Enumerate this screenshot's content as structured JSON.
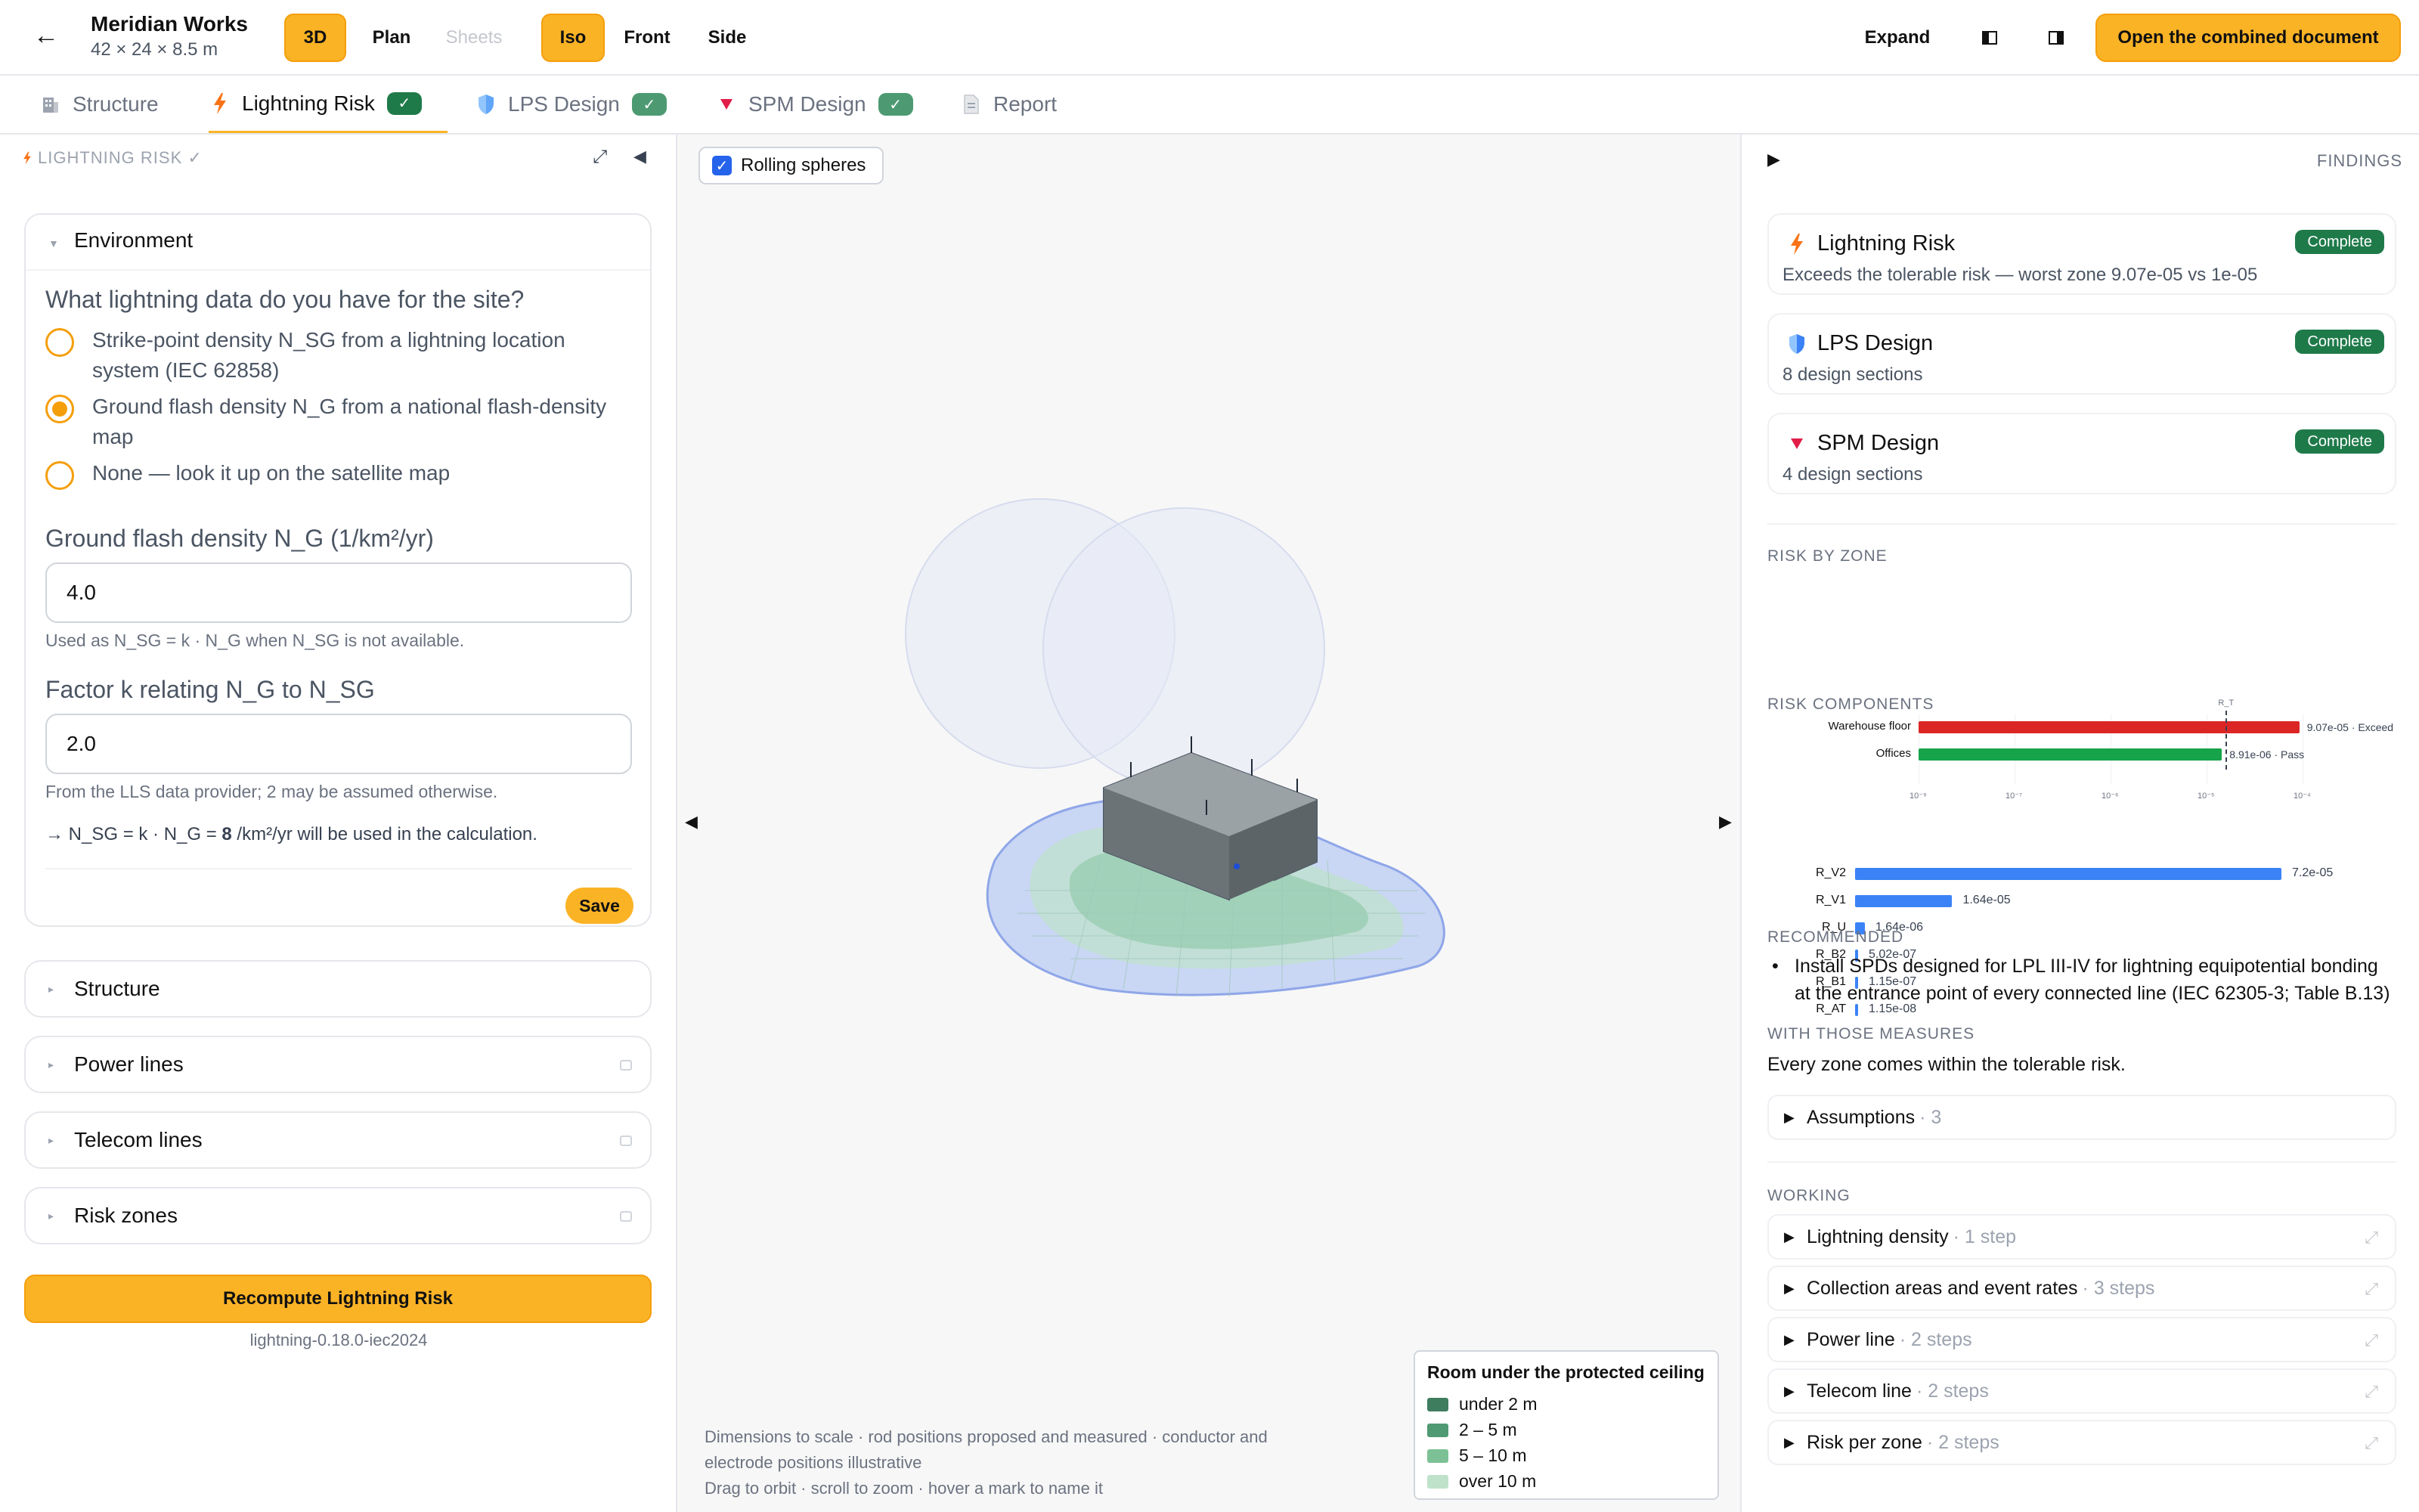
{
  "project": {
    "name": "Meridian Works",
    "dims": "42 × 24 × 8.5 m"
  },
  "toolbar": {
    "back": "←",
    "views": [
      "3D",
      "Plan",
      "Sheets"
    ],
    "cams": [
      "Iso",
      "Front",
      "Side"
    ],
    "expand": "Expand",
    "open_doc": "Open the combined document"
  },
  "tabs": [
    {
      "label": "Structure",
      "icon": "building-icon"
    },
    {
      "label": "Lightning Risk",
      "icon": "lightning-icon",
      "check": "✓"
    },
    {
      "label": "LPS Design",
      "icon": "shield-icon",
      "check": "✓"
    },
    {
      "label": "SPM Design",
      "icon": "triangle-icon",
      "check": "✓"
    },
    {
      "label": "Report",
      "icon": "document-icon"
    }
  ],
  "left": {
    "header": "LIGHTNING RISK ✓",
    "environment": {
      "title": "Environment",
      "question": "What lightning data do you have for the site?",
      "options": [
        "Strike-point density N_SG from a lightning location system (IEC 62858)",
        "Ground flash density N_G from a national flash-density map",
        "None — look it up on the satellite map"
      ],
      "selected_index": 1,
      "ng_label": "Ground flash density N_G (1/km²/yr)",
      "ng_value": "4.0",
      "ng_hint": "Used as N_SG = k · N_G when N_SG is not available.",
      "k_label": "Factor k relating N_G to N_SG",
      "k_value": "2.0",
      "k_hint": "From the LLS data provider; 2 may be assumed otherwise.",
      "calc_prefix": "→ N_SG = k · N_G = ",
      "calc_value": "8",
      "calc_suffix": " /km²/yr will be used in the calculation.",
      "save": "Save"
    },
    "sections": [
      "Structure",
      "Power lines",
      "Telecom lines",
      "Risk zones"
    ],
    "recompute": "Recompute Lightning Risk",
    "version": "lightning-0.18.0-iec2024"
  },
  "viewport": {
    "toggle": "Rolling spheres",
    "legend_title": "Room under the protected ceiling",
    "legend": [
      {
        "label": "under 2 m",
        "color": "#3f7d5f"
      },
      {
        "label": "2 – 5 m",
        "color": "#4f9a72"
      },
      {
        "label": "5 – 10 m",
        "color": "#7cc196"
      },
      {
        "label": "over 10 m",
        "color": "#bfe2cb"
      }
    ],
    "note1": "Dimensions to scale · rod positions proposed and measured · conductor and",
    "note2": "electrode positions illustrative",
    "note3": "Drag to orbit · scroll to zoom · hover a mark to name it"
  },
  "right": {
    "header": "FINDINGS",
    "findings": [
      {
        "title": "Lightning Risk",
        "sub": "Exceeds the tolerable risk — worst zone 9.07e-05 vs 1e-05",
        "badge": "Complete",
        "icon": "lightning-icon"
      },
      {
        "title": "LPS Design",
        "sub": "8 design sections",
        "badge": "Complete",
        "icon": "shield-icon"
      },
      {
        "title": "SPM Design",
        "sub": "4 design sections",
        "badge": "Complete",
        "icon": "triangle-icon"
      }
    ],
    "risk_by_zone_label": "RISK BY ZONE",
    "risk_components_label": "RISK COMPONENTS",
    "recommended_label": "RECOMMENDED",
    "recommended": "Install SPDs designed for LPL III-IV for lightning equipotential bonding at the entrance point of every connected line (IEC 62305-3; Table B.13)",
    "with_measures_label": "WITH THOSE MEASURES",
    "with_measures": "Every zone comes within the tolerable risk.",
    "assumptions": {
      "label": "Assumptions",
      "meta": "· 3"
    },
    "working_label": "WORKING",
    "working": [
      {
        "label": "Lightning density",
        "meta": "· 1 step"
      },
      {
        "label": "Collection areas and event rates",
        "meta": "· 3 steps"
      },
      {
        "label": "Power line",
        "meta": "· 2 steps"
      },
      {
        "label": "Telecom line",
        "meta": "· 2 steps"
      },
      {
        "label": "Risk per zone",
        "meta": "· 2 steps"
      }
    ]
  },
  "chart_data": [
    {
      "type": "bar",
      "orientation": "horizontal",
      "scale": "log",
      "categories": [
        "Warehouse floor",
        "Offices"
      ],
      "values": [
        9.07e-05,
        8.91e-06
      ],
      "value_labels": [
        "9.07e-05 · Exceed",
        "8.91e-06 · Pass"
      ],
      "colors": [
        "#dc2626",
        "#16a34a"
      ],
      "reference": {
        "label": "R_T",
        "value": 1e-05
      },
      "xlim": [
        1e-09,
        0.0001
      ],
      "ticks": [
        "10⁻⁹",
        "10⁻⁷",
        "10⁻⁶",
        "10⁻⁵",
        "10⁻⁴"
      ]
    },
    {
      "type": "bar",
      "orientation": "horizontal",
      "categories": [
        "R_V2",
        "R_V1",
        "R_U",
        "R_B2",
        "R_B1",
        "R_AT"
      ],
      "values": [
        7.2e-05,
        1.64e-05,
        1.64e-06,
        5.02e-07,
        1.15e-07,
        1.15e-08
      ],
      "value_labels": [
        "7.2e-05",
        "1.64e-05",
        "1.64e-06",
        "5.02e-07",
        "1.15e-07",
        "1.15e-08"
      ],
      "color": "#3b82f6"
    }
  ]
}
